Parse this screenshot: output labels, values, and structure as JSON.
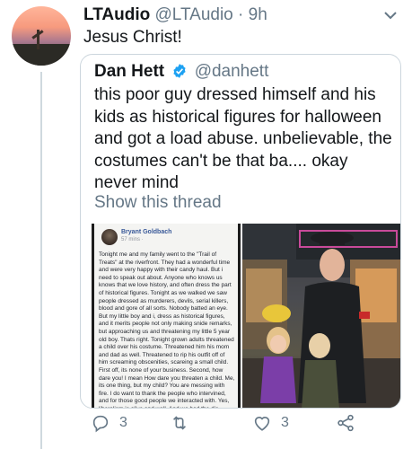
{
  "tweet": {
    "author_name": "LTAudio",
    "author_handle": "@LTAudio",
    "separator": "·",
    "time": "9h",
    "text": "Jesus Christ!",
    "avatar_icon": "profile-photo"
  },
  "quote": {
    "author_name": "Dan Hett",
    "author_handle": "@danhett",
    "text": "this poor guy dressed himself and his kids as historical figures for halloween and got a load abuse. unbelievable, the costumes can't be that ba.... okay never mind",
    "show_thread": "Show this thread",
    "image_left": {
      "fb_name": "Bryant Goldbach",
      "fb_time": "57 mins ·",
      "fb_text": "Tonight me and my family went to the \"Trail of Treats\" at the riverfront. They had a wonderful time and were very happy with their candy haul. But i need to speak out about. Anyone who knows us knows that we love history, and often dress the part of historical figures. Tonight as we walked we saw people dressed as murderers, devils, serial killers, blood and gore of all sorts. Nobody batted an eye. But my little boy and i, dress as historical figures, and it merits people not only making snide remarks, but approaching us and threatening my little 5 year old boy. Thats right. Tonight grown adults threatened a child over his costume. Threatened him his mom and dad as well. Threatened to rip his outfit off of him screaming obscenities, scareing a small child. First off, its none of your business. Second, how dare you! I mean How dare you threaten a child. Me, its one thing, but my child? You are messing with fire. I do want to thank the people who intervined, and for those good people we interacted with. Yes, liberalism is alive and well. And we had the dis-pleasure of dealing with the fruits of the so called \"Tolerant Left\"."
    }
  },
  "actions": {
    "reply_count": "3",
    "retweet_count": "",
    "like_count": "3",
    "share_count": ""
  },
  "colors": {
    "text_primary": "#14171a",
    "text_secondary": "#657786",
    "verified_blue": "#1da1f2",
    "border": "#ccd6dd"
  }
}
